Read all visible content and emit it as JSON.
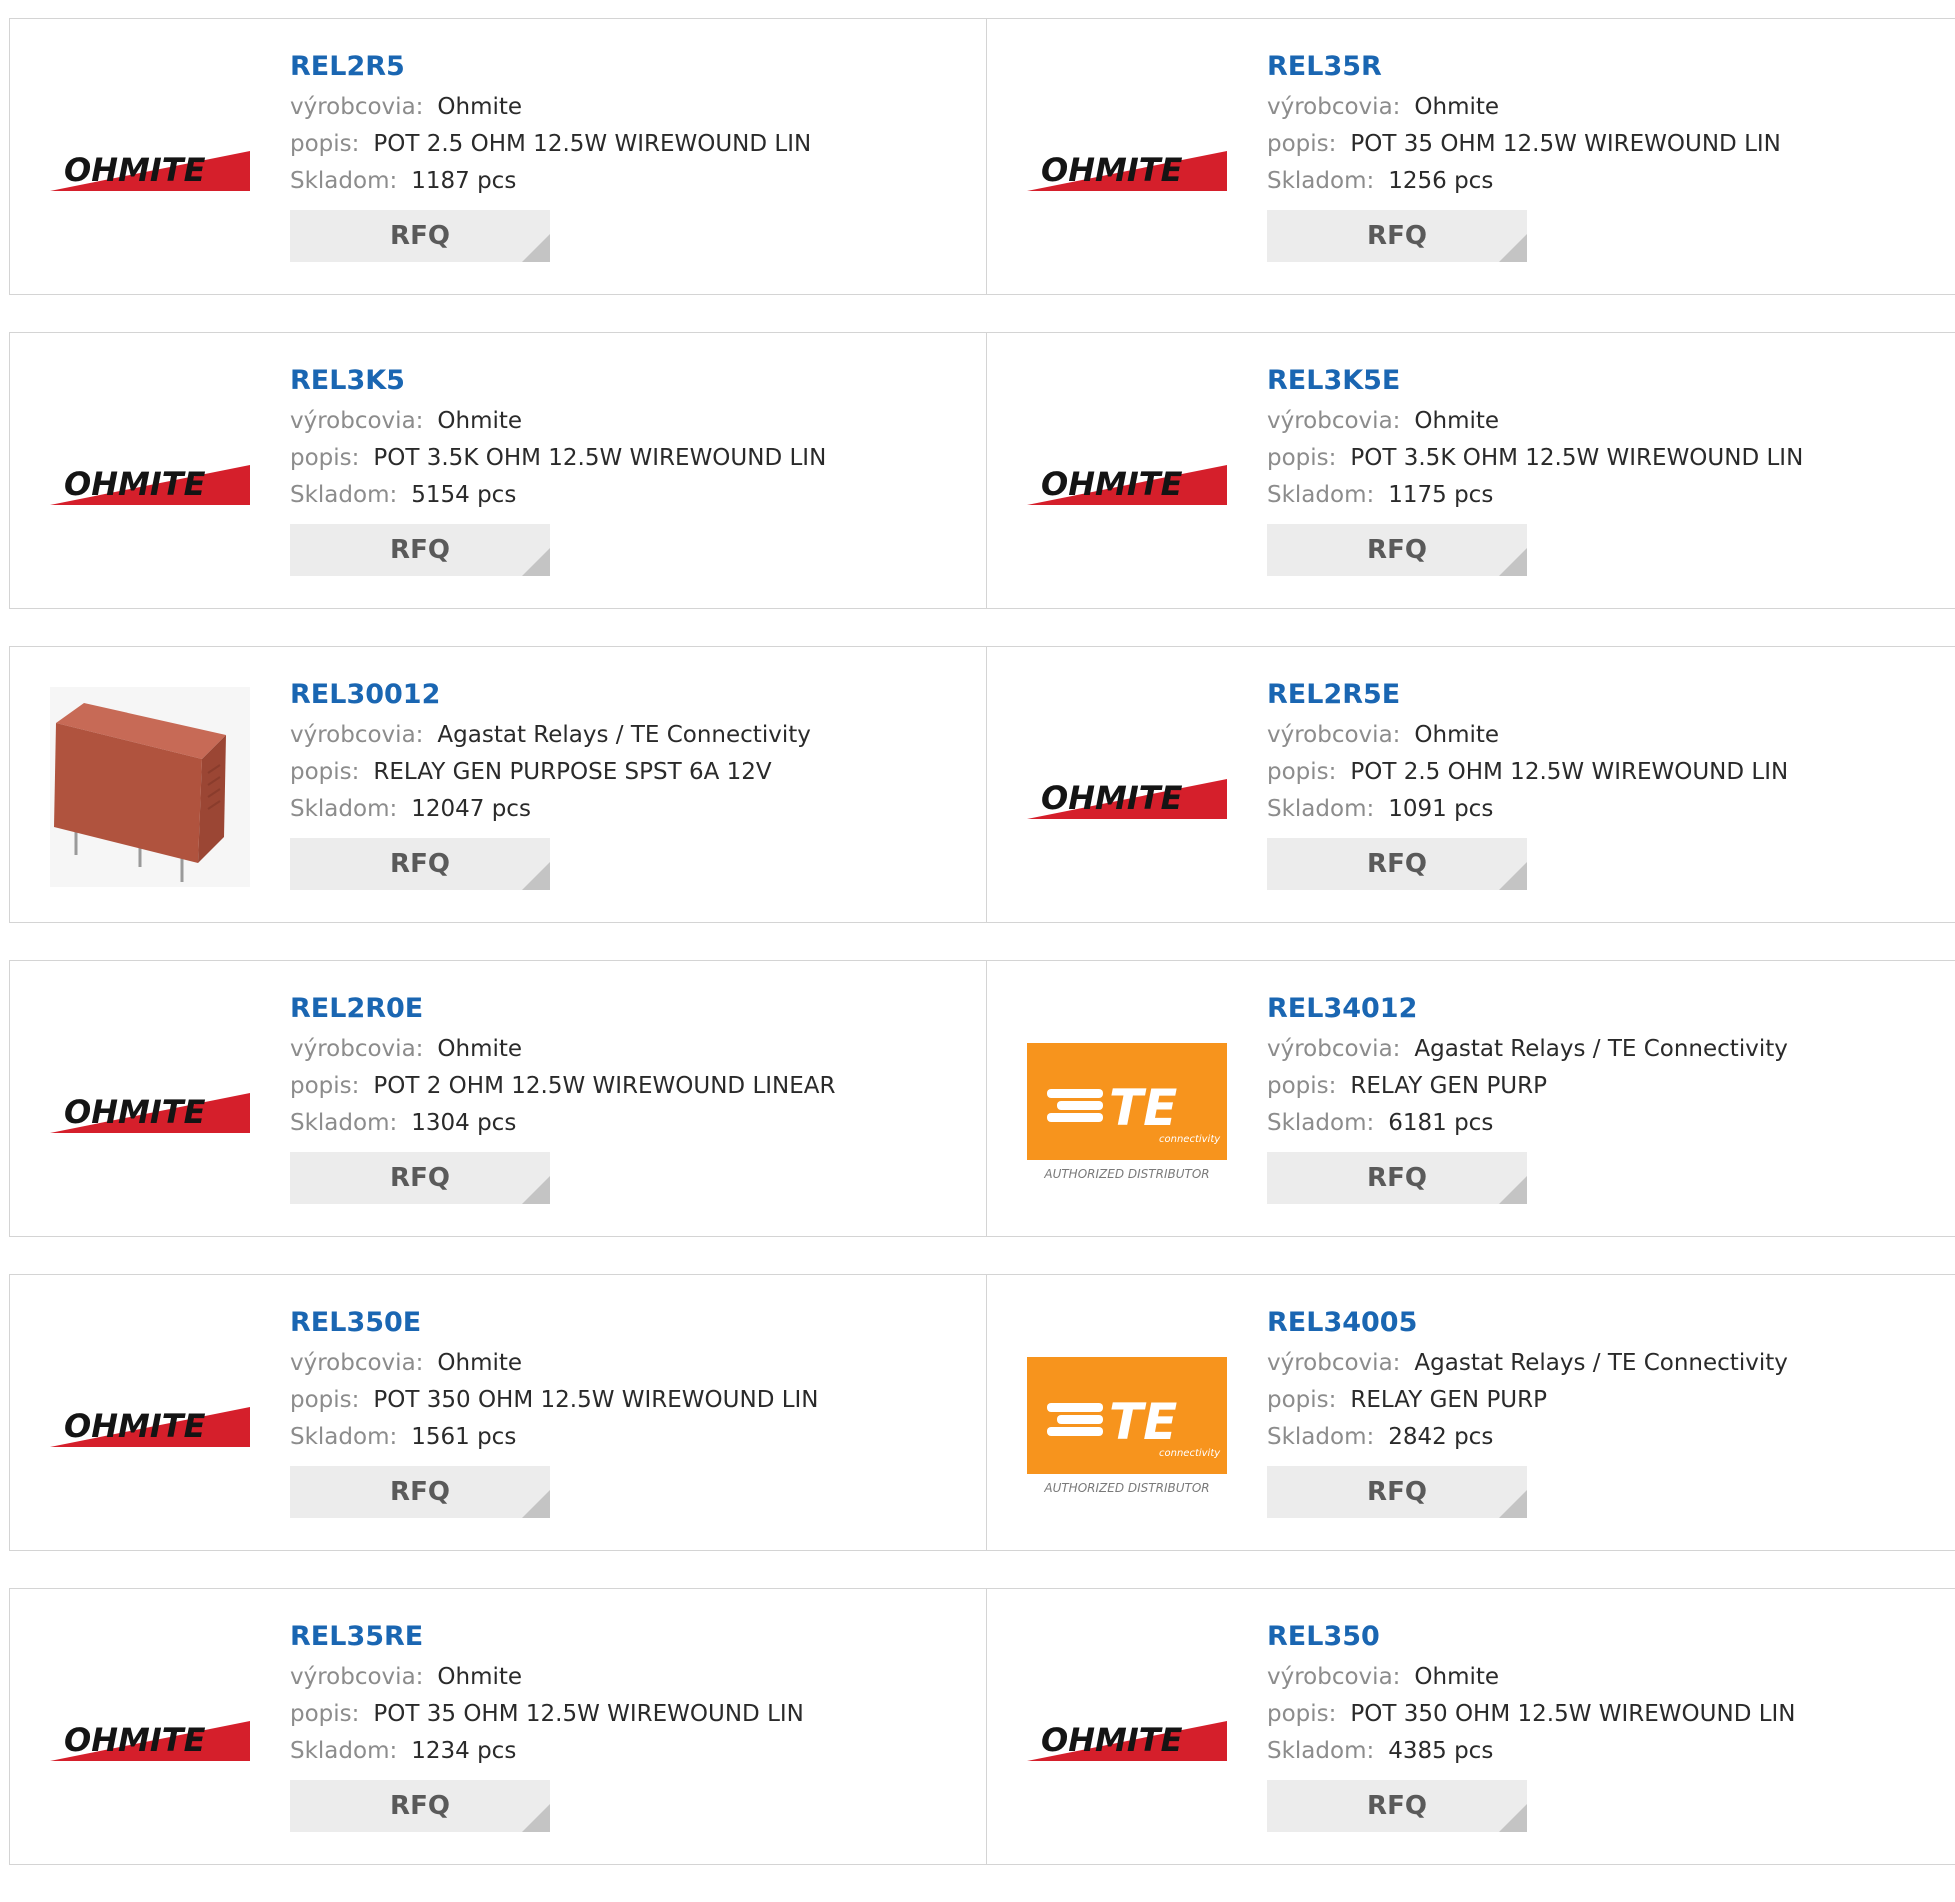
{
  "labels": {
    "manufacturer": "výrobcovia:",
    "description": "popis:",
    "stock": "Skladom:",
    "rfq": "RFQ"
  },
  "logos": {
    "ohmite": {
      "text": "OHMITE",
      "color": "#d51f2b"
    },
    "te": {
      "text": "TE",
      "sub": "connectivity",
      "caption": "AUTHORIZED DISTRIBUTOR",
      "color": "#f7941d"
    }
  },
  "products": [
    {
      "part": "REL2R5",
      "manufacturer": "Ohmite",
      "description": "POT 2.5 OHM 12.5W WIREWOUND LIN",
      "stock": "1187 pcs",
      "image": "ohmite-logo"
    },
    {
      "part": "REL35R",
      "manufacturer": "Ohmite",
      "description": "POT 35 OHM 12.5W WIREWOUND LIN",
      "stock": "1256 pcs",
      "image": "ohmite-logo"
    },
    {
      "part": "REL3K5",
      "manufacturer": "Ohmite",
      "description": "POT 3.5K OHM 12.5W WIREWOUND LIN",
      "stock": "5154 pcs",
      "image": "ohmite-logo"
    },
    {
      "part": "REL3K5E",
      "manufacturer": "Ohmite",
      "description": "POT 3.5K OHM 12.5W WIREWOUND LIN",
      "stock": "1175 pcs",
      "image": "ohmite-logo"
    },
    {
      "part": "REL30012",
      "manufacturer": "Agastat Relays / TE Connectivity",
      "description": "RELAY GEN PURPOSE SPST 6A 12V",
      "stock": "12047 pcs",
      "image": "relay-photo"
    },
    {
      "part": "REL2R5E",
      "manufacturer": "Ohmite",
      "description": "POT 2.5 OHM 12.5W WIREWOUND LIN",
      "stock": "1091 pcs",
      "image": "ohmite-logo"
    },
    {
      "part": "REL2R0E",
      "manufacturer": "Ohmite",
      "description": "POT 2 OHM 12.5W WIREWOUND LINEAR",
      "stock": "1304 pcs",
      "image": "ohmite-logo"
    },
    {
      "part": "REL34012",
      "manufacturer": "Agastat Relays / TE Connectivity",
      "description": "RELAY GEN PURP",
      "stock": "6181 pcs",
      "image": "te-logo"
    },
    {
      "part": "REL350E",
      "manufacturer": "Ohmite",
      "description": "POT 350 OHM 12.5W WIREWOUND LIN",
      "stock": "1561 pcs",
      "image": "ohmite-logo"
    },
    {
      "part": "REL34005",
      "manufacturer": "Agastat Relays / TE Connectivity",
      "description": "RELAY GEN PURP",
      "stock": "2842 pcs",
      "image": "te-logo"
    },
    {
      "part": "REL35RE",
      "manufacturer": "Ohmite",
      "description": "POT 35 OHM 12.5W WIREWOUND LIN",
      "stock": "1234 pcs",
      "image": "ohmite-logo"
    },
    {
      "part": "REL350",
      "manufacturer": "Ohmite",
      "description": "POT 350 OHM 12.5W WIREWOUND LIN",
      "stock": "4385 pcs",
      "image": "ohmite-logo"
    }
  ]
}
